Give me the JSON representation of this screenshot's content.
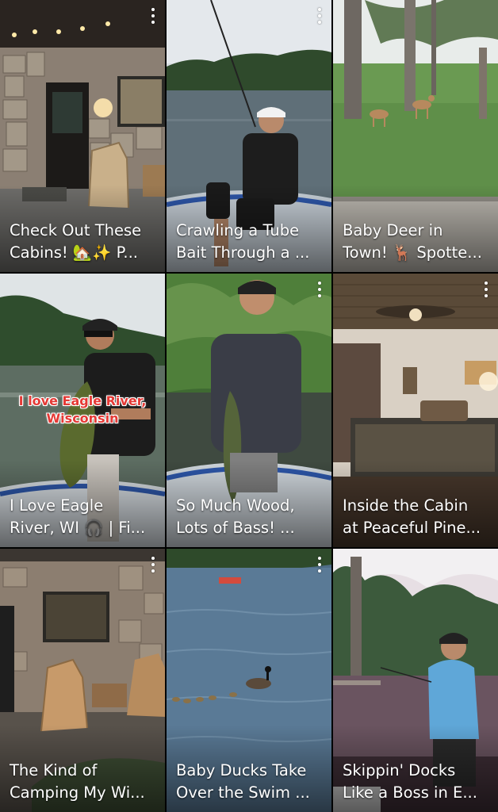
{
  "tiles": [
    {
      "title": "Check Out These\nCabins! 🏡✨ P...",
      "menu_icon": "more-vert-icon"
    },
    {
      "title": "Crawling a Tube\nBait Through a ...",
      "menu_icon": "more-vert-icon"
    },
    {
      "title": "Baby Deer in\nTown! 🦌 Spotte...",
      "menu_icon": "more-vert-icon"
    },
    {
      "title": "I Love Eagle\nRiver, WI 🎧 | Fi...",
      "overlay": "I love Eagle River,\nWisconsin",
      "menu_icon": "more-vert-icon"
    },
    {
      "title": "So Much Wood,\nLots of Bass! ...",
      "menu_icon": "more-vert-icon"
    },
    {
      "title": "Inside the Cabin\nat Peaceful Pine...",
      "menu_icon": "more-vert-icon"
    },
    {
      "title": "The Kind of\nCamping My Wi...",
      "menu_icon": "more-vert-icon"
    },
    {
      "title": "Baby Ducks Take\nOver the Swim ...",
      "menu_icon": "more-vert-icon"
    },
    {
      "title": "Skippin' Docks\nLike a Boss in E...",
      "menu_icon": "more-vert-icon"
    }
  ]
}
